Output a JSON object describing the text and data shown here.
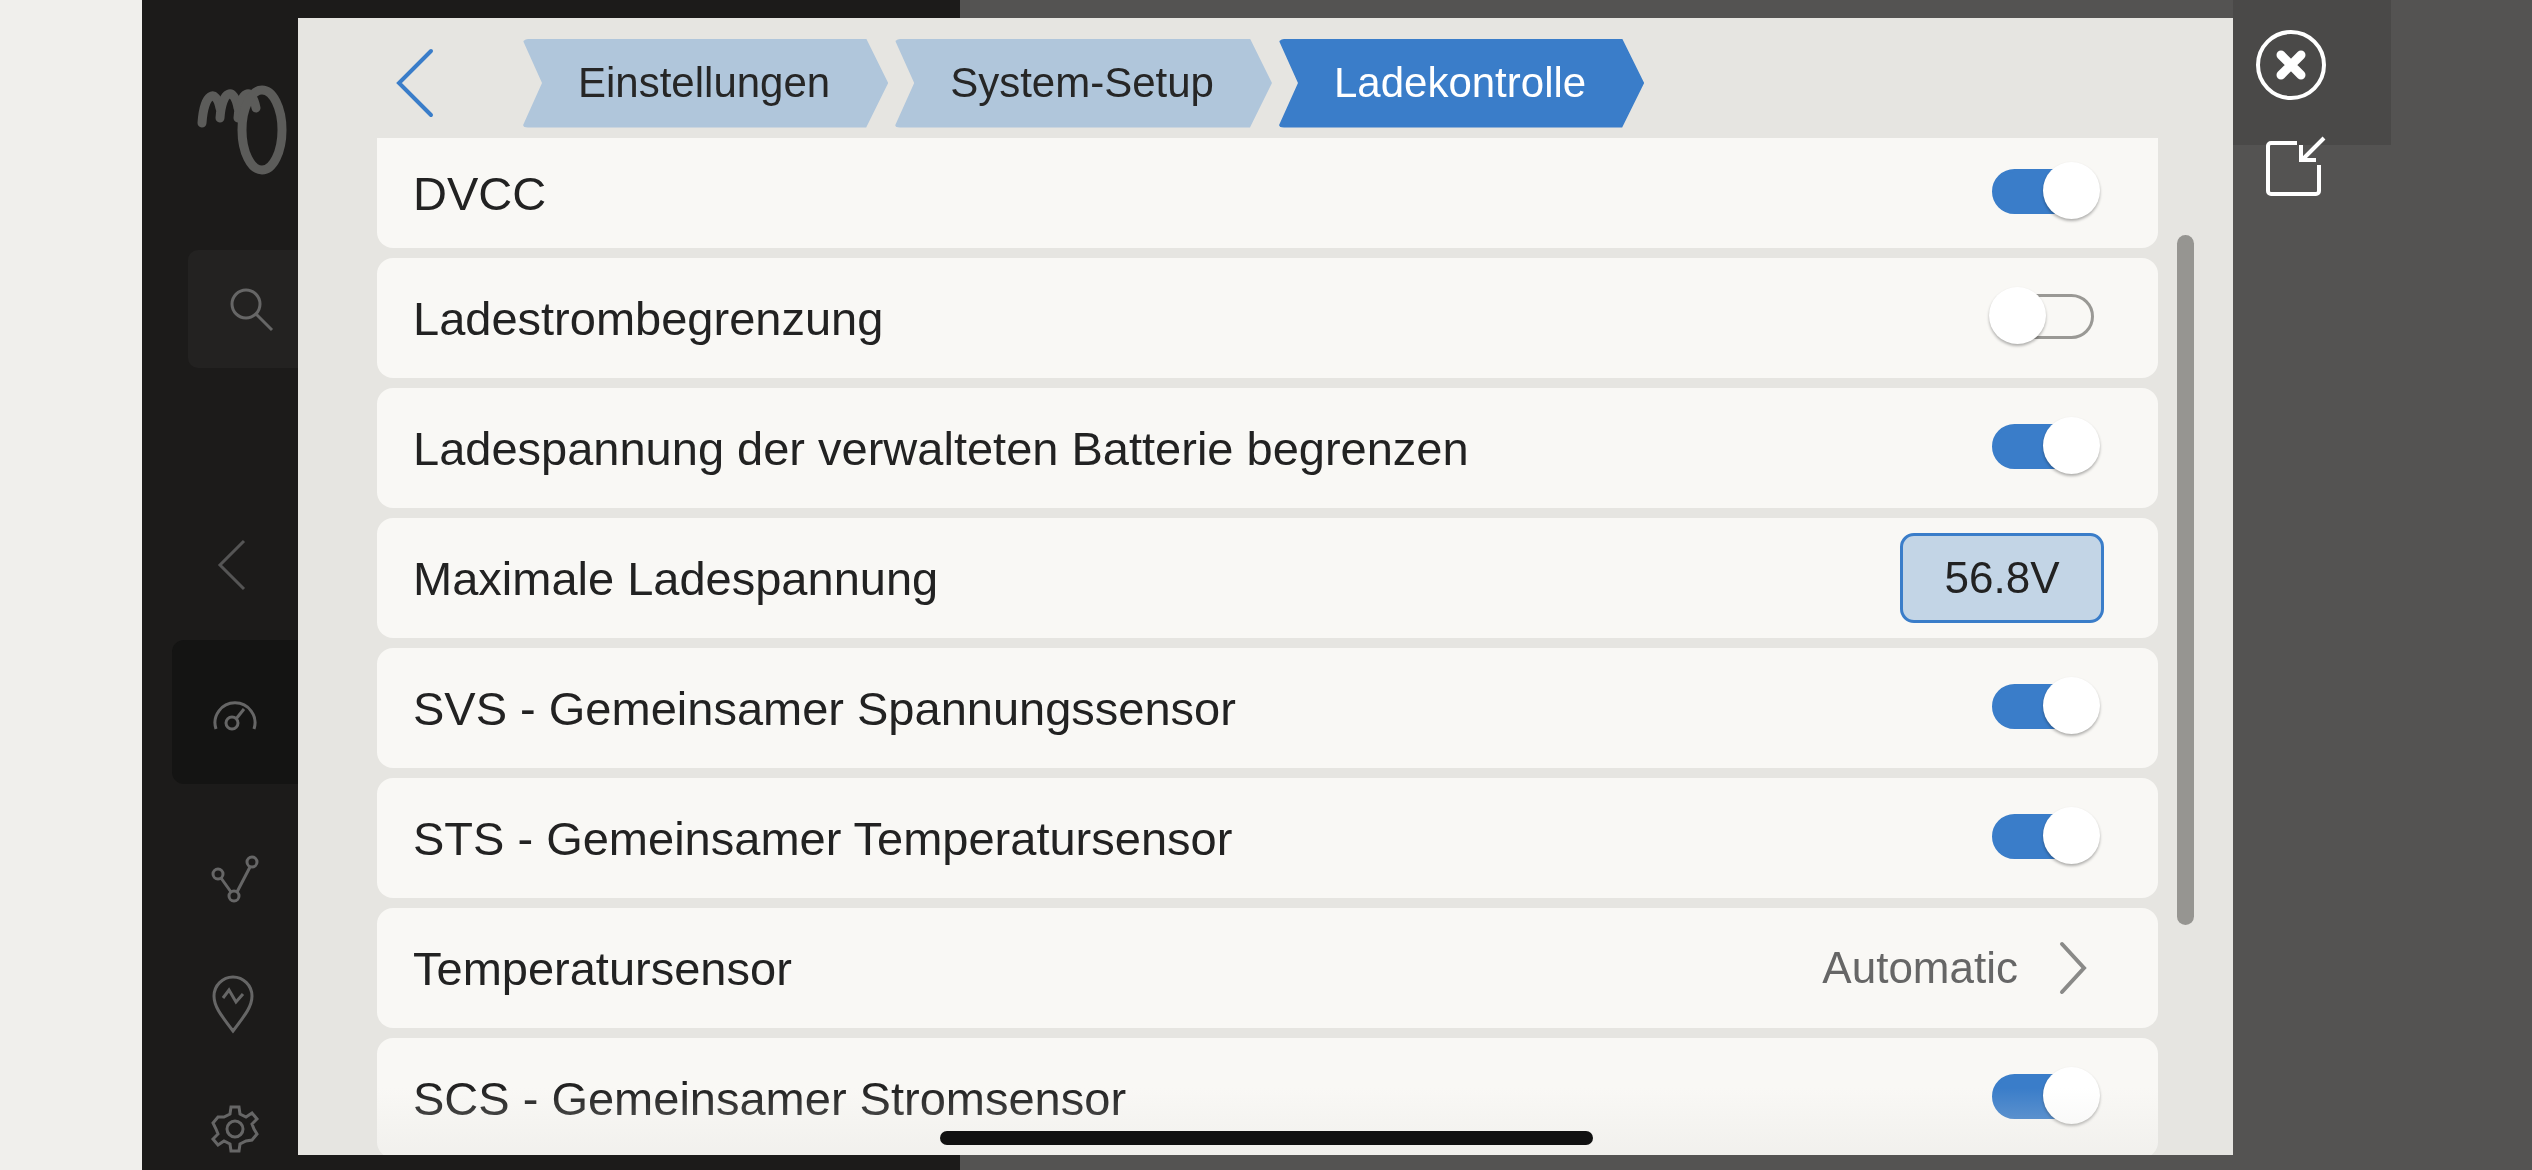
{
  "breadcrumbs": [
    {
      "label": "Einstellungen",
      "selected": false
    },
    {
      "label": "System-Setup",
      "selected": false
    },
    {
      "label": "Ladekontrolle",
      "selected": true
    }
  ],
  "settings": [
    {
      "kind": "toggle",
      "label": "DVCC",
      "on": true
    },
    {
      "kind": "toggle",
      "label": "Ladestrombegrenzung",
      "on": false
    },
    {
      "kind": "toggle",
      "label": "Ladespannung der verwalteten Batterie begrenzen",
      "on": true
    },
    {
      "kind": "value",
      "label": "Maximale Ladespannung",
      "value": "56.8V"
    },
    {
      "kind": "toggle",
      "label": "SVS - Gemeinsamer Spannungssensor",
      "on": true
    },
    {
      "kind": "toggle",
      "label": "STS - Gemeinsamer Temperatursensor",
      "on": true
    },
    {
      "kind": "link",
      "label": "Temperatursensor",
      "value": "Automatic"
    },
    {
      "kind": "toggle",
      "label": "SCS - Gemeinsamer Stromsensor",
      "on": true
    }
  ]
}
